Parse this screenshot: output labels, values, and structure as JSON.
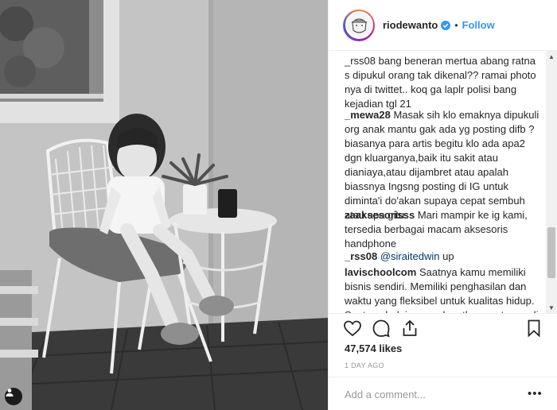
{
  "header": {
    "username": "riodewanto",
    "separator": "•",
    "follow_label": "Follow",
    "verified_icon": "verified-badge-icon"
  },
  "comments": [
    {
      "user": "",
      "text": "_rss08 bang beneran mertua abang ratna s dipukul orang tak dikenal?? ramai photo nya di twittet.. koq ga laplr polisi bang kejadian tgl 21"
    },
    {
      "user": "_mewa28",
      "text": "Masak sih klo emaknya dipukuli org anak mantu gak ada yg posting difb ? biasanya para artis begitu klo ada apa2 dgn kluarganya,baik itu sakit atau dianiaya,atau dijambret atau apalah biassnya Ingsng posting di IG untuk diminta'i do'akan supaya cepat sembuh atau apa gitu."
    },
    {
      "user": "zaaksesorisss",
      "text": "Mari mampir ke ig kami, tersedia berbagai macam aksesoris handphone"
    },
    {
      "user": "_rss08",
      "mention": "@siraitedwin",
      "text": "up"
    },
    {
      "user": "lavischoolcom",
      "text": "Saatnya kamu memiliki bisnis sendiri. Memiliki penghasilan dan waktu yang fleksibel untuk kualitas hidup. Saatnya belajar mendapatkan customer di"
    }
  ],
  "actions": {
    "like_icon": "heart-icon",
    "comment_icon": "comment-bubble-icon",
    "share_icon": "share-icon",
    "save_icon": "bookmark-icon",
    "likes_text": "47,574 likes",
    "timestamp": "1 DAY AGO"
  },
  "comment_box": {
    "placeholder": "Add a comment...",
    "more_label": "•••"
  },
  "colors": {
    "link_blue": "#3897f0",
    "text": "#262626",
    "muted": "#999999"
  }
}
